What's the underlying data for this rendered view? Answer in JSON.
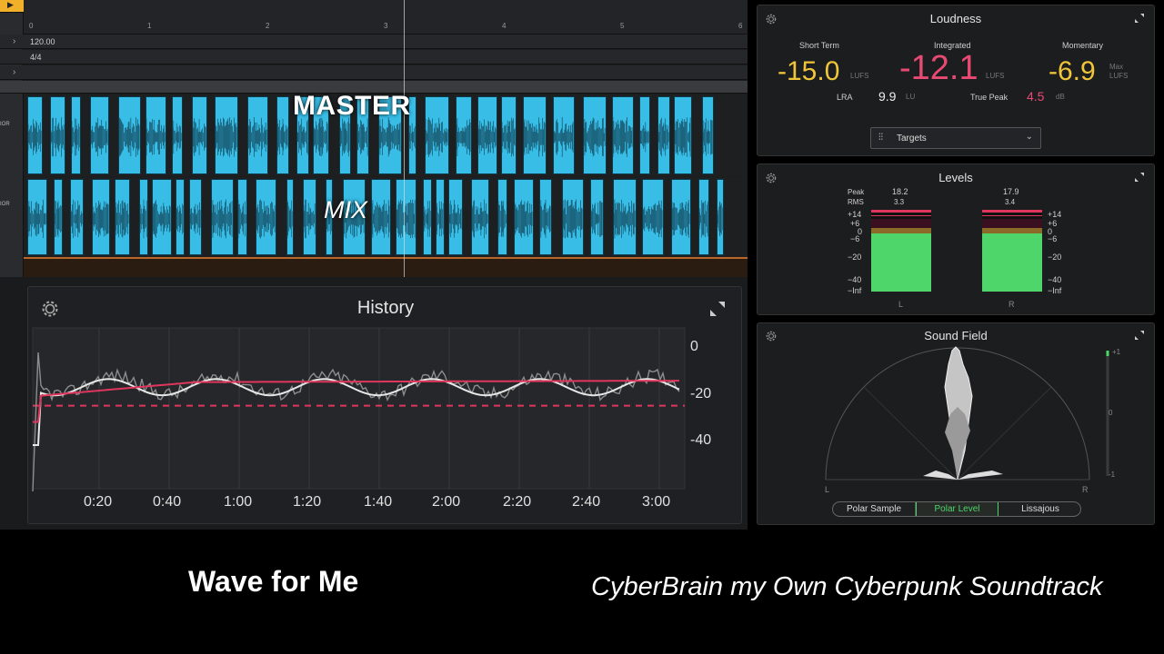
{
  "daw": {
    "ruler_ticks": [
      "0",
      "1",
      "2",
      "3",
      "4",
      "5",
      "6"
    ],
    "tempo": "120.00",
    "signature": "4/4",
    "track_master": "MASTER",
    "track_mix": "MIX"
  },
  "history": {
    "title": "History",
    "y_ticks": [
      "0",
      "-20",
      "-40"
    ],
    "x_ticks": [
      "0:20",
      "0:40",
      "1:00",
      "1:20",
      "1:40",
      "2:00",
      "2:20",
      "2:40",
      "3:00"
    ],
    "colors": {
      "short_term": "#e7e7e7",
      "integrated": "#e0365e",
      "target": "#e0365e",
      "momentary": "#8d8d8d"
    }
  },
  "loudness": {
    "title": "Loudness",
    "short_term_label": "Short Term",
    "integrated_label": "Integrated",
    "momentary_label": "Momentary",
    "short_term_value": "-15.0",
    "integrated_value": "-12.1",
    "momentary_value": "-6.9",
    "unit_lufs": "LUFS",
    "unit_max": "Max",
    "lra_label": "LRA",
    "lra_value": "9.9",
    "lra_unit": "LU",
    "true_peak_label": "True Peak",
    "true_peak_value": "4.5",
    "true_peak_unit": "dB",
    "targets_label": "Targets",
    "colors": {
      "short_term": "#f0c53a",
      "integrated": "#e84a73",
      "momentary": "#f0c53a",
      "true_peak": "#e84a73"
    }
  },
  "levels": {
    "title": "Levels",
    "peak_label": "Peak",
    "rms_label": "RMS",
    "left": {
      "peak": "18.2",
      "rms": "3.3",
      "channel": "L"
    },
    "right": {
      "peak": "17.9",
      "rms": "3.4",
      "channel": "R"
    },
    "scale": [
      "+14",
      "+6",
      "0",
      "−6",
      "−20",
      "−40",
      "−Inf"
    ]
  },
  "sound_field": {
    "title": "Sound Field",
    "left_label": "L",
    "right_label": "R",
    "corr_top": "+1",
    "corr_mid": "0",
    "corr_bottom": "-1",
    "modes": [
      "Polar Sample",
      "Polar Level",
      "Lissajous"
    ],
    "active_mode": "Polar Level"
  },
  "captions": {
    "song": "Wave for Me",
    "album": "CyberBrain my Own Cyberpunk Soundtrack"
  }
}
